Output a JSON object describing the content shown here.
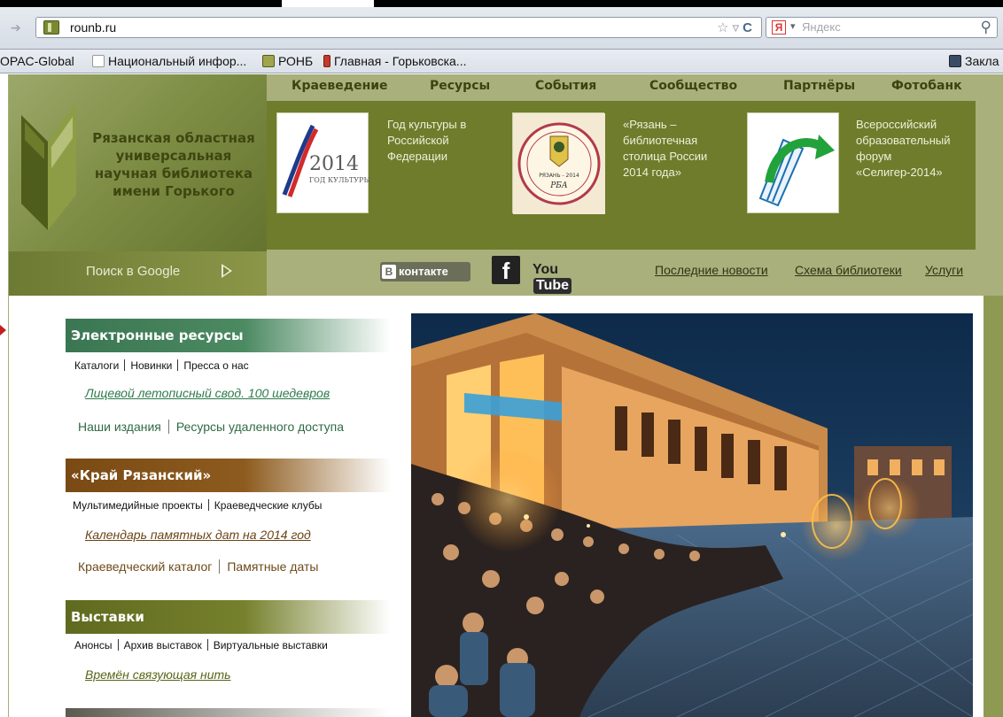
{
  "browser": {
    "url": "rounb.ru",
    "search_engine": "Яндекс",
    "yandex_badge": "Я",
    "bookmarks": [
      {
        "label": "OPAC-Global"
      },
      {
        "label": "Национальный инфор..."
      },
      {
        "label": "РОНБ"
      },
      {
        "label": "Главная - Горьковска..."
      }
    ],
    "bookmarks_right": "Закла"
  },
  "header": {
    "logo_title": "Рязанская областная универсальная научная библиотека имени Горького",
    "google_search": "Поиск в Google",
    "nav": [
      "Краеведение",
      "Ресурсы",
      "События",
      "Сообщество",
      "Партнёры",
      "Фотобанк"
    ],
    "features": [
      {
        "text": "Год культуры в Российской Федерации",
        "image_label": "2014",
        "image_sub": "ГОД КУЛЬТУРЫ"
      },
      {
        "text": "«Рязань – библиотечная столица России 2014 года»",
        "image_label": "РЯЗАНЬ - 2014",
        "image_sub": "РБА"
      },
      {
        "text": "Всероссийский образовательный форум «Селигер-2014»"
      }
    ],
    "social": {
      "vk_b": "В",
      "vk": "контакте",
      "fb": "f",
      "yt_you": "You",
      "yt_tube": "Tube"
    },
    "links": [
      "Последние новости",
      "Схема библиотеки",
      "Услуги"
    ]
  },
  "sections": {
    "electronic": {
      "title": "Электронные ресурсы",
      "links": [
        "Каталоги",
        "Новинки",
        "Пресса о нас"
      ],
      "featured": "Лицевой летописный свод. 100 шедевров",
      "links2": [
        "Наши издания",
        "Ресурсы удаленного доступа"
      ]
    },
    "krai": {
      "title": "«Край Рязанский»",
      "links": [
        "Мультимедийные проекты",
        "Краеведческие клубы"
      ],
      "featured": "Календарь памятных дат на 2014 год",
      "links2": [
        "Краеведческий каталог",
        "Памятные даты"
      ]
    },
    "exhibitions": {
      "title": "Выставки",
      "links": [
        "Анонсы",
        "Архив выставок",
        "Виртуальные выставки"
      ],
      "featured": "Времён связующая нить"
    }
  },
  "colors": {
    "header_olive": "#a9b07c",
    "feature_band": "#6e7c2c",
    "electronic_green": "#3a7652",
    "krai_brown": "#7a4a14",
    "exhibitions_olive": "#5f6a1f"
  }
}
